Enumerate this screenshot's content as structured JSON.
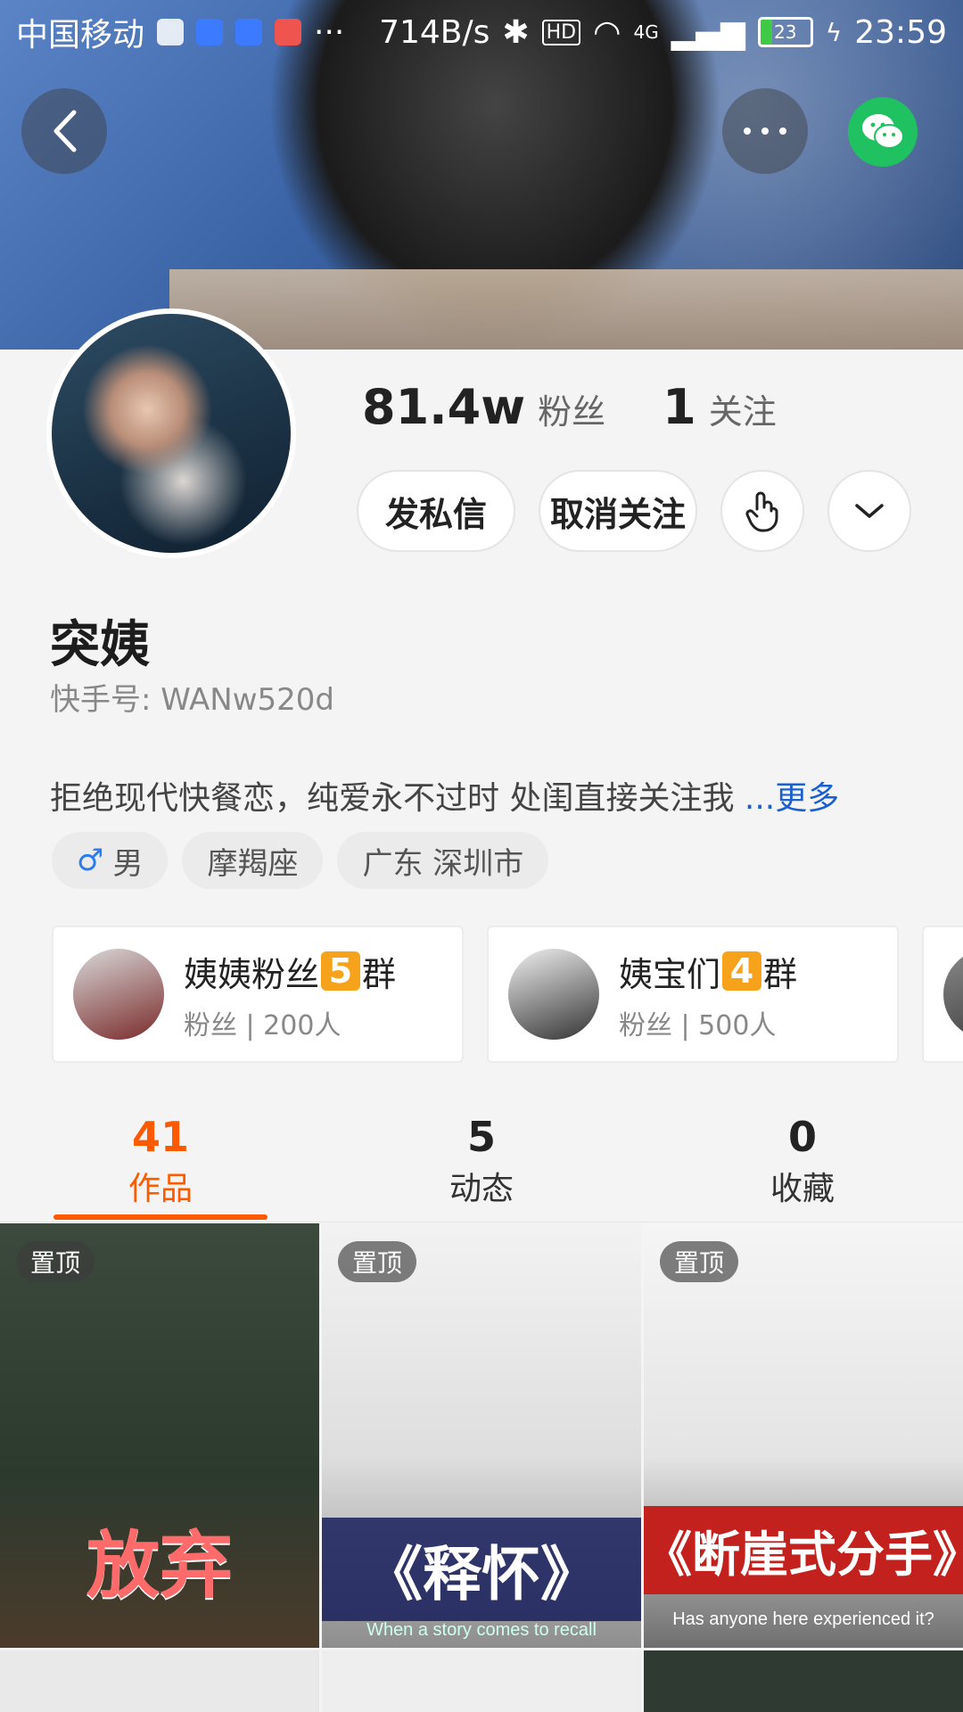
{
  "status_bar": {
    "carrier": "中国移动",
    "speed": "714B/s",
    "hd": "HD",
    "network": "4G",
    "battery": "23",
    "time": "23:59"
  },
  "header": {
    "back_icon": "chevron-left-icon",
    "more_icon": "more-horizontal-icon",
    "share_icon": "wechat-icon"
  },
  "profile": {
    "followers_count": "81.4w",
    "followers_label": "粉丝",
    "following_count": "1",
    "following_label": "关注",
    "message_button": "发私信",
    "unfollow_button": "取消关注",
    "name": "突姨",
    "kuaishou_id": "快手号: WANw520d",
    "bio": "拒绝现代快餐恋，纯爱永不过时 处闺直接关注我",
    "bio_more": "...更多",
    "tags": {
      "gender": "男",
      "zodiac": "摩羯座",
      "location": "广东 深圳市"
    }
  },
  "groups": [
    {
      "title_prefix": "姨姨粉丝",
      "number": "5",
      "title_suffix": "群",
      "subtitle": "粉丝 | 200人"
    },
    {
      "title_prefix": "姨宝们",
      "number": "4",
      "title_suffix": "群",
      "subtitle": "粉丝 | 500人"
    }
  ],
  "tabs": [
    {
      "count": "41",
      "label": "作品",
      "active": true
    },
    {
      "count": "5",
      "label": "动态",
      "active": false
    },
    {
      "count": "0",
      "label": "收藏",
      "active": false
    }
  ],
  "videos": [
    {
      "pin": "置顶",
      "caption": "放弃",
      "subcaption": ""
    },
    {
      "pin": "置顶",
      "caption": "《释怀》",
      "subcaption": "When a story comes to recall"
    },
    {
      "pin": "置顶",
      "caption": "《断崖式分手》",
      "subcaption": "Has anyone here experienced it?"
    }
  ],
  "colors": {
    "accent": "#ff5a00",
    "link": "#1b5fd1",
    "wechat": "#20c160",
    "badge": "#f7a21b"
  }
}
